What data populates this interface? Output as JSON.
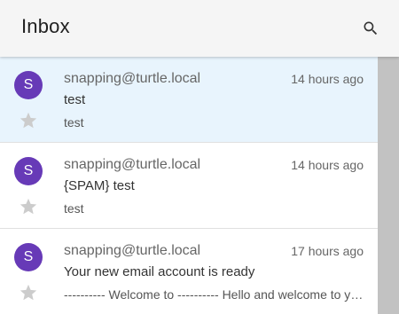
{
  "appbar": {
    "title": "Inbox",
    "search_icon": "search-icon"
  },
  "colors": {
    "appbar_bg": "#f5f5f5",
    "selected_row_bg": "#e8f4fd",
    "avatar_bg": "#673ab7",
    "star_color": "#cccccc",
    "scrollbar": "#c2c2c2"
  },
  "messages": [
    {
      "avatar_letter": "S",
      "sender": "snapping@turtle.local",
      "time": "14 hours ago",
      "subject": "test",
      "preview": "test",
      "selected": true,
      "starred": false
    },
    {
      "avatar_letter": "S",
      "sender": "snapping@turtle.local",
      "time": "14 hours ago",
      "subject": "{SPAM} test",
      "preview": "test",
      "selected": false,
      "starred": false
    },
    {
      "avatar_letter": "S",
      "sender": "snapping@turtle.local",
      "time": "17 hours ago",
      "subject": "Your new email account is ready",
      "preview": "---------- Welcome to ---------- Hello and welcome to your...",
      "selected": false,
      "starred": false
    }
  ]
}
